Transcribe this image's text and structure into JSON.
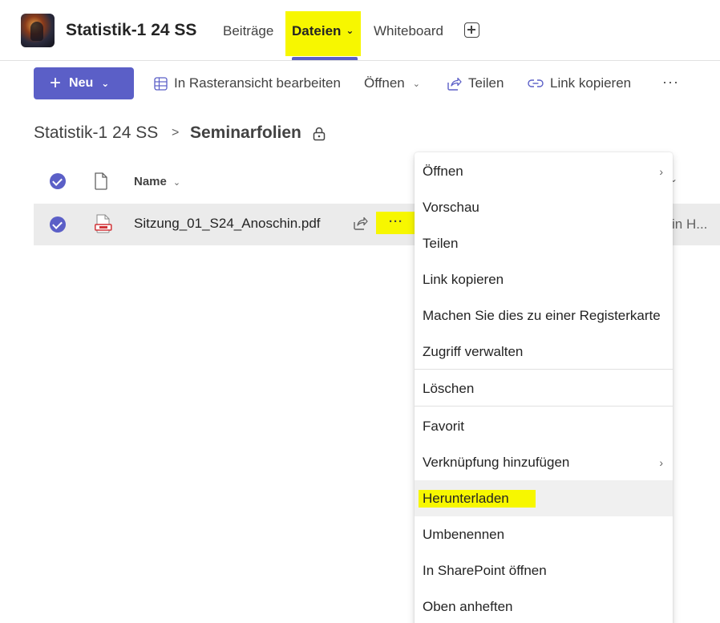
{
  "header": {
    "team_name": "Statistik-1 24 SS",
    "tabs": [
      {
        "label": "Beiträge"
      },
      {
        "label": "Dateien"
      },
      {
        "label": "Whiteboard"
      }
    ],
    "accent_color": "#5b5fc7",
    "highlight_color": "#f7f700"
  },
  "toolbar": {
    "new_label": "Neu",
    "grid_label": "In Rasteransicht bearbeiten",
    "open_label": "Öffnen",
    "share_label": "Teilen",
    "copy_link_label": "Link kopieren",
    "more_label": "···"
  },
  "breadcrumb": {
    "root": "Statistik-1 24 SS",
    "separator": ">",
    "current": "Seminarfolien"
  },
  "file_list": {
    "column_name": "Name",
    "rows": [
      {
        "name": "Sitzung_01_S24_Anoschin.pdf",
        "more": "···",
        "truncated_text": "in H..."
      }
    ]
  },
  "context_menu": {
    "items": [
      {
        "label": "Öffnen",
        "submenu": true
      },
      {
        "label": "Vorschau"
      },
      {
        "label": "Teilen"
      },
      {
        "label": "Link kopieren"
      },
      {
        "label": "Machen Sie dies zu einer Registerkarte"
      },
      {
        "label": "Zugriff verwalten"
      },
      {
        "label": "Löschen"
      },
      {
        "label": "Favorit"
      },
      {
        "label": "Verknüpfung hinzufügen",
        "submenu": true
      },
      {
        "label": "Herunterladen",
        "highlighted": true
      },
      {
        "label": "Umbenennen"
      },
      {
        "label": "In SharePoint öffnen"
      },
      {
        "label": "Oben anheften"
      }
    ]
  }
}
